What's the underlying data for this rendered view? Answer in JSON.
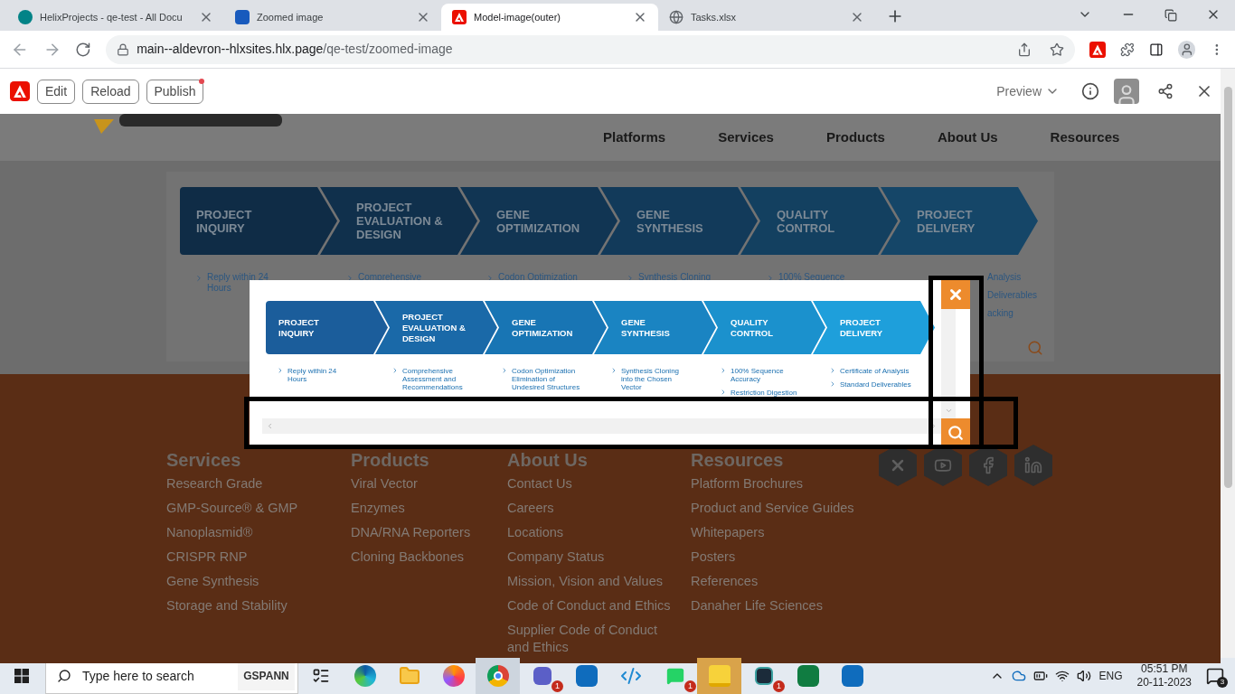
{
  "browser": {
    "tabs": [
      {
        "title": "HelixProjects - qe-test - All Docu",
        "kind": "sharepoint",
        "selected": false
      },
      {
        "title": "Zoomed image",
        "kind": "word",
        "selected": false
      },
      {
        "title": "Model-image(outer)",
        "kind": "adobe",
        "selected": true
      },
      {
        "title": "Tasks.xlsx",
        "kind": "globe",
        "selected": false
      }
    ],
    "address": {
      "host": "main--aldevron--hlxsites.hlx.page",
      "path": "/qe-test/zoomed-image"
    }
  },
  "sidekick": {
    "buttons": [
      {
        "label": "Edit",
        "dot": false
      },
      {
        "label": "Reload",
        "dot": false
      },
      {
        "label": "Publish",
        "dot": true
      }
    ],
    "environment": "Preview"
  },
  "site": {
    "nav": [
      "Platforms",
      "Services",
      "Products",
      "About Us",
      "Resources"
    ],
    "backdrop_stages": [
      {
        "title": "PROJECT\nINQUIRY",
        "partial": false,
        "bullets": [
          "Reply within 24\nHours"
        ]
      },
      {
        "title": "PROJECT\nEVALUATION &\nDESIGN",
        "partial": false,
        "bullets": [
          "Comprehensive"
        ]
      },
      {
        "title": "GENE\nOPTIMIZATION",
        "partial": false,
        "bullets": [
          "Codon Optimization"
        ]
      },
      {
        "title": "GENE\nSYNTHESIS",
        "partial": false,
        "bullets": [
          "Synthesis Cloning"
        ]
      },
      {
        "title": "QUALITY\nCONTROL",
        "partial": false,
        "bullets": [
          "100% Sequence"
        ]
      },
      {
        "title": "PROJECT\nDELIVERY",
        "partial": true,
        "bullets": [
          "Analysis",
          "Deliverables",
          "acking"
        ]
      }
    ],
    "modal": {
      "stages": [
        {
          "title": "PROJECT\nINQUIRY",
          "bullets": [
            "Reply within 24\nHours"
          ]
        },
        {
          "title": "PROJECT\nEVALUATION &\nDESIGN",
          "bullets": [
            "Comprehensive\nAssessment and\nRecommendations"
          ]
        },
        {
          "title": "GENE\nOPTIMIZATION",
          "bullets": [
            "Codon Optimization\nElimination of\nUndesired Structures"
          ]
        },
        {
          "title": "GENE\nSYNTHESIS",
          "bullets": [
            "Synthesis Cloning\ninto the Chosen\nVector"
          ]
        },
        {
          "title": "QUALITY\nCONTROL",
          "bullets": [
            "100% Sequence\nAccuracy",
            "Restriction Digestion"
          ]
        },
        {
          "title": "PROJECT\nDELIVERY",
          "bullets": [
            "Certificate of Analysis",
            "Standard Deliverables"
          ]
        }
      ]
    },
    "footer": {
      "columns": [
        {
          "heading": "Services",
          "links": [
            "Research Grade",
            "GMP-Source® & GMP",
            "Nanoplasmid®",
            "CRISPR RNP",
            "Gene Synthesis",
            "Storage and Stability"
          ]
        },
        {
          "heading": "Products",
          "links": [
            "Viral Vector",
            "Enzymes",
            "DNA/RNA Reporters",
            "Cloning Backbones"
          ]
        },
        {
          "heading": "About Us",
          "links": [
            "Contact Us",
            "Careers",
            "Locations",
            "Company Status",
            "Mission, Vision and Values",
            "Code of Conduct and Ethics",
            "Supplier Code of Conduct\nand Ethics"
          ]
        },
        {
          "heading": "Resources",
          "links": [
            "Platform Brochures",
            "Product and Service Guides",
            "Whitepapers",
            "Posters",
            "References",
            "Danaher Life Sciences"
          ]
        }
      ],
      "social": [
        {
          "kind": "x"
        },
        {
          "kind": "youtube"
        },
        {
          "kind": "facebook"
        },
        {
          "kind": "linkedin"
        }
      ]
    }
  },
  "taskbar": {
    "search_placeholder": "Type here to search",
    "search_badge": "GSPANN",
    "apps": [
      {
        "kind": "taskview",
        "selected": false
      },
      {
        "kind": "edge",
        "selected": false
      },
      {
        "kind": "folder",
        "selected": false
      },
      {
        "kind": "firefox",
        "selected": false
      },
      {
        "kind": "chrome",
        "selected": true
      },
      {
        "kind": "teams",
        "selected": false,
        "badge": "1"
      },
      {
        "kind": "outlook",
        "selected": false
      },
      {
        "kind": "vscode",
        "selected": false
      },
      {
        "kind": "whatsapp",
        "selected": false,
        "badge": "1"
      },
      {
        "kind": "sticky",
        "selected": true
      },
      {
        "kind": "app",
        "selected": false,
        "badge": "1"
      },
      {
        "kind": "excel",
        "selected": false
      },
      {
        "kind": "outlook",
        "selected": false
      }
    ],
    "language": "ENG",
    "time": "05:51 PM",
    "date": "20-11-2023",
    "notifications": "3"
  }
}
